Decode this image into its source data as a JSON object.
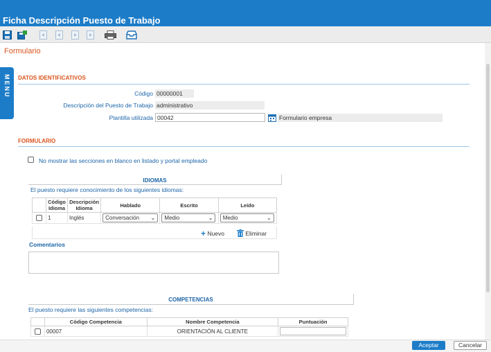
{
  "window": {
    "title": "Ficha Descripción Puesto de Trabajo"
  },
  "toolbar": {
    "icons": [
      "save-icon",
      "save-all-icon",
      "first-record-icon",
      "previous-record-icon",
      "next-record-icon",
      "last-record-icon",
      "print-icon",
      "inbox-icon"
    ]
  },
  "page": {
    "subtitle": "Formulario",
    "menu_tab": "MENU"
  },
  "datos": {
    "heading": "DATOS IDENTIFICATIVOS",
    "codigo_label": "Código",
    "codigo_value": "00000001",
    "descripcion_label": "Descripción del Puesto de Trabajo",
    "descripcion_value": "administrativo",
    "plantilla_label": "Plantilla utilizada",
    "plantilla_value": "00042",
    "plantilla_desc": "Formulario empresa"
  },
  "formulario": {
    "heading": "FORMULARIO",
    "no_mostrar_label": "No mostrar las secciones en blanco en listado y portal empleado"
  },
  "idiomas": {
    "heading": "IDIOMAS",
    "intro": "El puesto requiere conocimiento de los siguientes idiomas:",
    "columns": {
      "codigo": "Código Idioma",
      "descripcion": "Descripción Idioma",
      "hablado": "Hablado",
      "escrito": "Escrito",
      "leido": "Leído"
    },
    "rows": [
      {
        "codigo": "1",
        "descripcion": "Inglés",
        "hablado": "Conversación",
        "escrito": "Medio",
        "leido": "Medio"
      }
    ],
    "nuevo_label": "Nuevo",
    "eliminar_label": "Eliminar"
  },
  "comentarios": {
    "label": "Comentarios"
  },
  "competencias": {
    "heading": "COMPETENCIAS",
    "intro": "El puesto requiere las siguientes competencias:",
    "columns": {
      "codigo": "Código Competencia",
      "nombre": "Nombre Competencia",
      "puntuacion": "Puntuación"
    },
    "rows": [
      {
        "codigo": "00007",
        "nombre": "ORIENTACIÓN AL CLIENTE",
        "puntuacion": ""
      }
    ]
  },
  "footer": {
    "aceptar_label": "Aceptar",
    "cancelar_label": "Cancelar"
  },
  "colors": {
    "brand_blue": "#1c7cc8",
    "section_orange": "#d9541e",
    "label_blue": "#1c64a8"
  }
}
